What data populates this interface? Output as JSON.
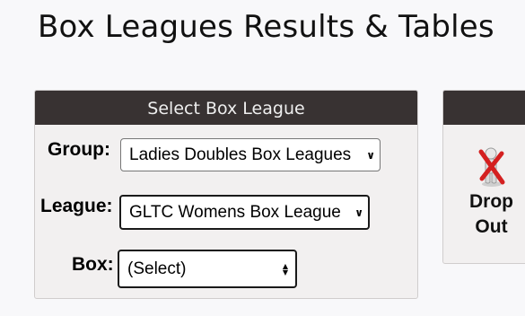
{
  "page": {
    "title": "Box Leagues Results & Tables"
  },
  "select_panel": {
    "header": "Select Box League",
    "group": {
      "label": "Group:",
      "selected": "Ladies Doubles Box Leagues"
    },
    "league": {
      "label": "League:",
      "selected": "GLTC Womens Box League"
    },
    "box": {
      "label": "Box:",
      "selected": "(Select)"
    }
  },
  "action_panel": {
    "drop_out": {
      "line1": "Drop",
      "line2": "Out",
      "icon": "person-cross-icon"
    }
  },
  "colors": {
    "header_bg": "#383232",
    "panel_bg": "#f2f0f0",
    "page_bg": "#f8f8fa",
    "cross_red": "#d42020"
  }
}
